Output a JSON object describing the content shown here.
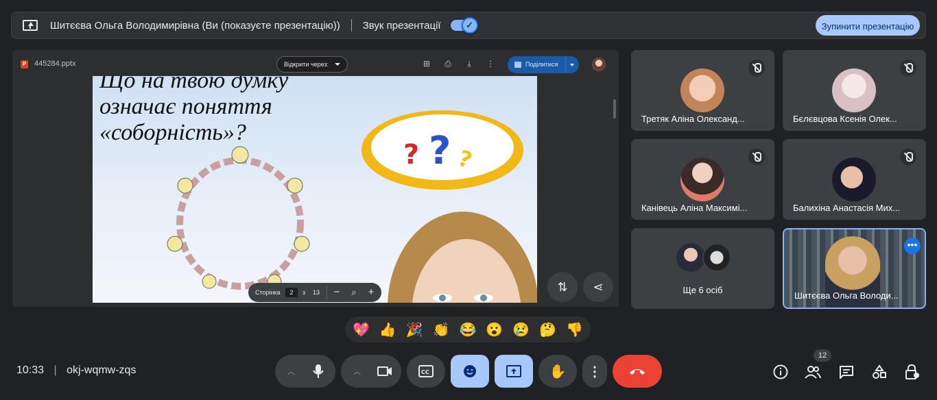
{
  "banner": {
    "title": "Шитєєва Ольга Володимирівна (Ви (показуєте презентацію))",
    "sound_label": "Звук презентації",
    "sound_on": true,
    "stop_button": "Зупинити презентацію"
  },
  "viewer": {
    "file_name": "445284.pptx",
    "file_icon": "P",
    "open_with": "Відкрити через:",
    "share_label": "Поділитися",
    "slide_title": "Що на твою думку означає поняття «соборність»?",
    "pager": {
      "label": "Сторінка",
      "current": "2",
      "of": "з",
      "total": "13"
    }
  },
  "participants": [
    {
      "name": "Третяк Аліна Олександ...",
      "muted": true
    },
    {
      "name": "Бєлєвцова Ксенія Олек...",
      "muted": true
    },
    {
      "name": "Канівець Аліна Максимі...",
      "muted": true
    },
    {
      "name": "Балихіна Анастасія Мих...",
      "muted": true
    },
    {
      "name": "Ще 6 осіб",
      "muted": false
    },
    {
      "name": "Шитєєва Ольга Володи...",
      "muted": false
    }
  ],
  "reactions": [
    "💖",
    "👍",
    "🎉",
    "👏",
    "😂",
    "😮",
    "😢",
    "🤔",
    "👎"
  ],
  "footer": {
    "time": "10:33",
    "meeting_code": "okj-wqmw-zqs",
    "people_count": "12"
  },
  "colors": {
    "accent": "#a8c7fa",
    "end_call": "#ea4335",
    "background": "#202124"
  }
}
